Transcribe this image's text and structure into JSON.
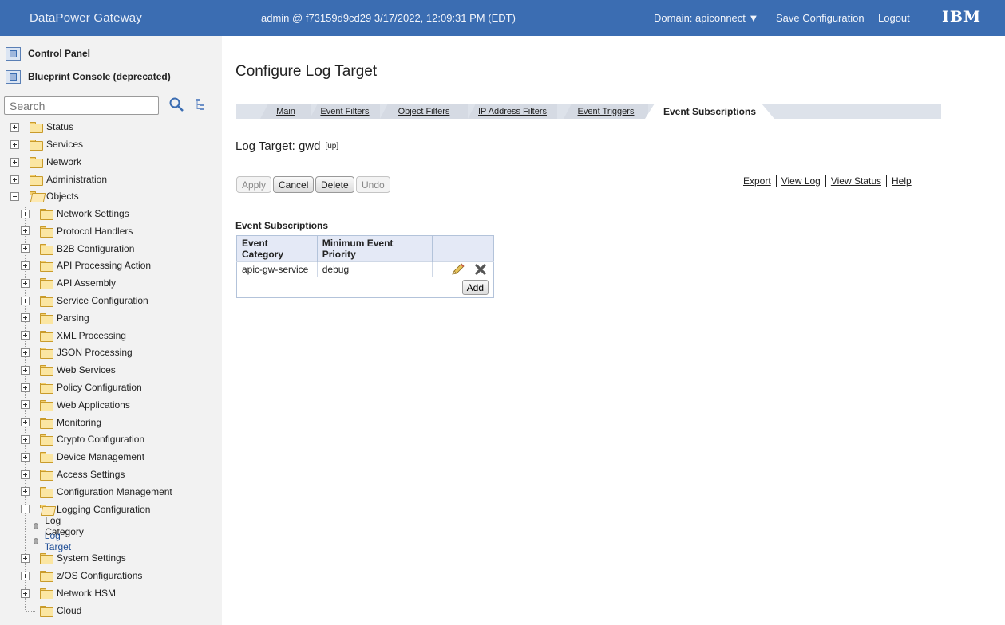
{
  "banner": {
    "brand": "DataPower Gateway",
    "session": "admin @ f73159d9cd29 3/17/2022, 12:09:31 PM (EDT)",
    "domain_label": "Domain: apiconnect ▼",
    "save_config": "Save Configuration",
    "logout": "Logout",
    "ibm_logo": "IBM"
  },
  "sidebar": {
    "control_panel": "Control Panel",
    "blueprint_console": "Blueprint Console (deprecated)",
    "search_placeholder": "Search",
    "tree": [
      {
        "label": "Status",
        "state": "collapsed"
      },
      {
        "label": "Services",
        "state": "collapsed"
      },
      {
        "label": "Network",
        "state": "collapsed"
      },
      {
        "label": "Administration",
        "state": "collapsed"
      },
      {
        "label": "Objects",
        "state": "expanded"
      }
    ],
    "objects": [
      {
        "label": "Network Settings"
      },
      {
        "label": "Protocol Handlers"
      },
      {
        "label": "B2B Configuration"
      },
      {
        "label": "API Processing Action"
      },
      {
        "label": "API Assembly"
      },
      {
        "label": "Service Configuration"
      },
      {
        "label": "Parsing"
      },
      {
        "label": "XML Processing"
      },
      {
        "label": "JSON Processing"
      },
      {
        "label": "Web Services"
      },
      {
        "label": "Policy Configuration"
      },
      {
        "label": "Web Applications"
      },
      {
        "label": "Monitoring"
      },
      {
        "label": "Crypto Configuration"
      },
      {
        "label": "Device Management"
      },
      {
        "label": "Access Settings"
      },
      {
        "label": "Configuration Management"
      },
      {
        "label": "Logging Configuration"
      }
    ],
    "logging_children": [
      "Log Category",
      "Log Target"
    ],
    "objects_tail": [
      {
        "label": "System Settings"
      },
      {
        "label": "z/OS Configurations"
      },
      {
        "label": "Network HSM"
      },
      {
        "label": "Cloud"
      }
    ]
  },
  "main": {
    "title": "Configure Log Target",
    "tabs": [
      {
        "label": "Main"
      },
      {
        "label": "Event Filters"
      },
      {
        "label": "Object Filters"
      },
      {
        "label": "IP Address Filters"
      },
      {
        "label": "Event Triggers"
      },
      {
        "label": "Event Subscriptions",
        "active": true
      }
    ],
    "object_header": "Log Target: gwd",
    "up_link": "[up]",
    "buttons": {
      "apply": "Apply",
      "cancel": "Cancel",
      "delete": "Delete",
      "undo": "Undo"
    },
    "links": {
      "export": "Export",
      "view_log": "View Log",
      "view_status": "View Status",
      "help": "Help"
    },
    "section_title": "Event Subscriptions",
    "table": {
      "headers": [
        "Event Category",
        "Minimum Event Priority",
        ""
      ],
      "rows": [
        {
          "category": "apic-gw-service",
          "priority": "debug"
        }
      ],
      "add_label": "Add"
    }
  }
}
